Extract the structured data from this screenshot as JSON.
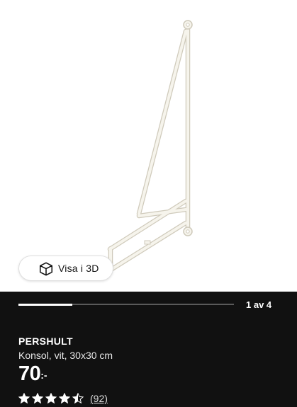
{
  "product_image": {
    "view_3d_label": "Visa i 3D",
    "cube_icon": "cube-icon"
  },
  "gallery": {
    "counter_text": "1 av 4",
    "progress_fraction": 0.25
  },
  "product": {
    "name": "PERSHULT",
    "description": "Konsol, vit, 30x30 cm",
    "price_amount": "70",
    "price_suffix": ":-",
    "rating_value": 4.5,
    "rating_max": 5,
    "review_count_text": "(92)"
  },
  "colors": {
    "panel_background": "#111111",
    "bracket_fill": "#f4f2ea",
    "bracket_outline": "#cfcabb"
  }
}
